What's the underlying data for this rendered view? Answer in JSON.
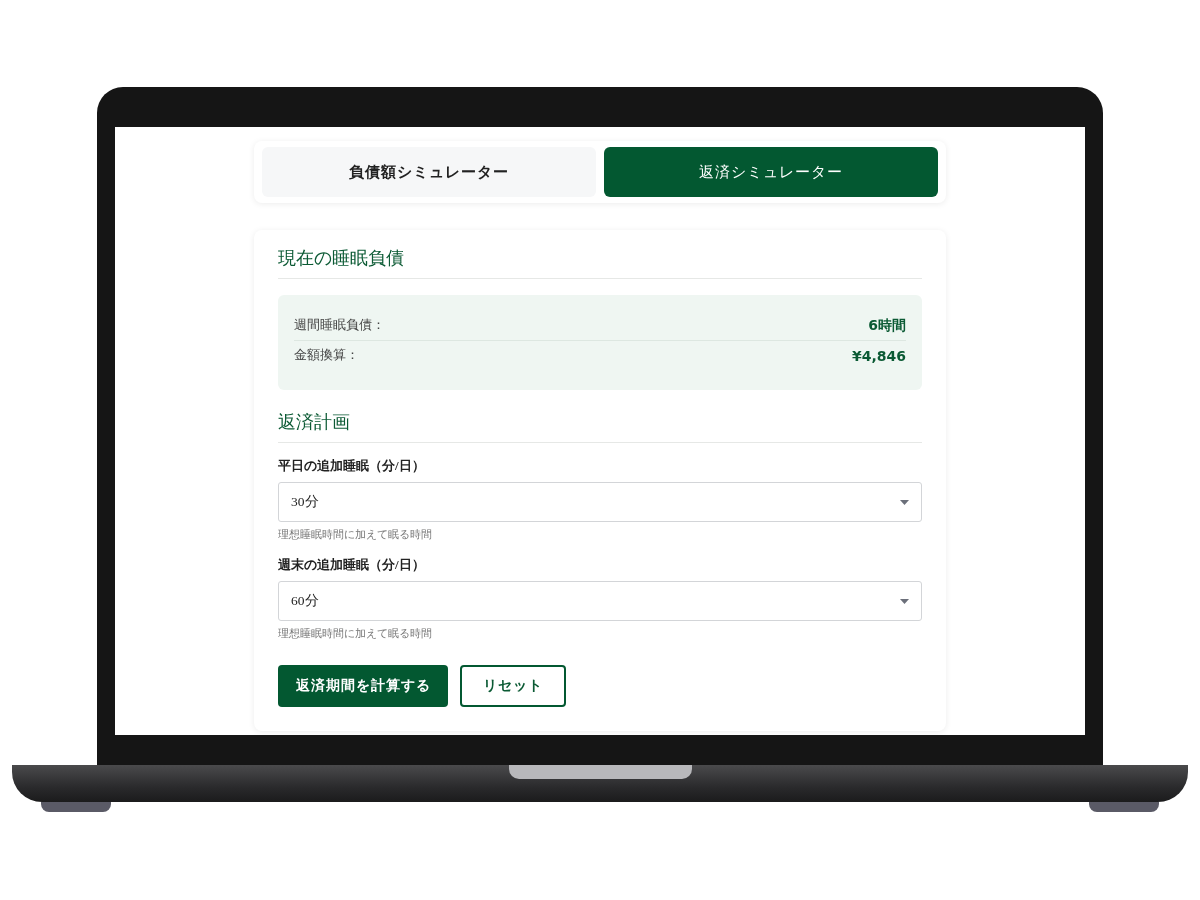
{
  "tabs": [
    {
      "label": "負債額シミュレーター",
      "selected": false
    },
    {
      "label": "返済シミュレーター",
      "selected": true
    }
  ],
  "current_debt": {
    "title": "現在の睡眠負債",
    "rows": [
      {
        "label": "週間睡眠負債：",
        "value": "6時間"
      },
      {
        "label": "金額換算：",
        "value": "¥4,846"
      }
    ]
  },
  "plan": {
    "title": "返済計画",
    "fields": [
      {
        "label": "平日の追加睡眠（分/日）",
        "value": "30分",
        "hint": "理想睡眠時間に加えて眠る時間"
      },
      {
        "label": "週末の追加睡眠（分/日）",
        "value": "60分",
        "hint": "理想睡眠時間に加えて眠る時間"
      }
    ]
  },
  "buttons": [
    {
      "label": "返済期間を計算する",
      "kind": "primary"
    },
    {
      "label": "リセット",
      "kind": "outline"
    }
  ]
}
